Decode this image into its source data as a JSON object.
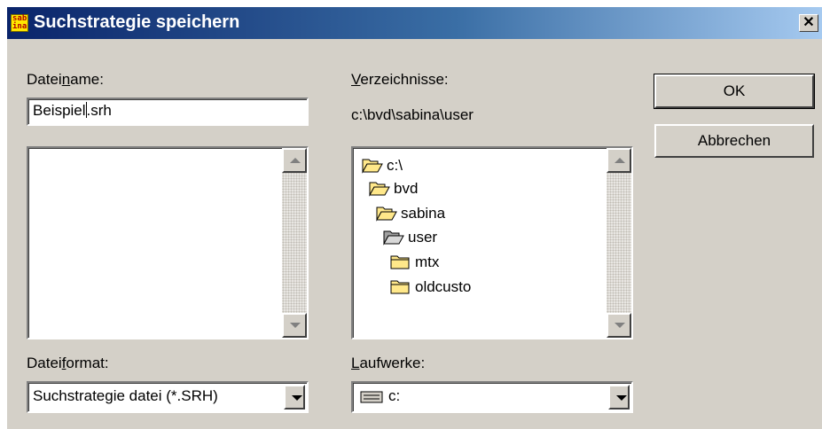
{
  "window": {
    "title": "Suchstrategie speichern",
    "app_icon_text_line1": "sab",
    "app_icon_text_line2": "ina",
    "close_glyph": "✕"
  },
  "filename": {
    "label_pre": "Datei",
    "label_accel": "n",
    "label_post": "ame:",
    "value_before_caret": "Beispiel",
    "value_after_caret": ".srh"
  },
  "directories": {
    "label_accel": "V",
    "label_post": "erzeichnisse:",
    "current_path": "c:\\bvd\\sabina\\user",
    "items": [
      {
        "label": "c:\\",
        "icon": "folder-open-icon"
      },
      {
        "label": "bvd",
        "icon": "folder-open-icon"
      },
      {
        "label": "sabina",
        "icon": "folder-open-icon"
      },
      {
        "label": "user",
        "icon": "folder-open-selected-icon"
      },
      {
        "label": "mtx",
        "icon": "folder-closed-icon"
      },
      {
        "label": "oldcusto",
        "icon": "folder-closed-icon"
      }
    ]
  },
  "fileformat": {
    "label_pre": "Datei",
    "label_accel": "f",
    "label_post": "ormat:",
    "selected": "Suchstrategie datei (*.SRH)"
  },
  "drives": {
    "label_accel": "L",
    "label_post": "aufwerke:",
    "selected": "c:",
    "icon": "drive-icon"
  },
  "buttons": {
    "ok": "OK",
    "cancel": "Abbrechen"
  },
  "colors": {
    "titlebar_start": "#0a246a",
    "titlebar_end": "#a6caf0",
    "dialog_bg": "#d4d0c8",
    "folder": "#ffe88a"
  }
}
